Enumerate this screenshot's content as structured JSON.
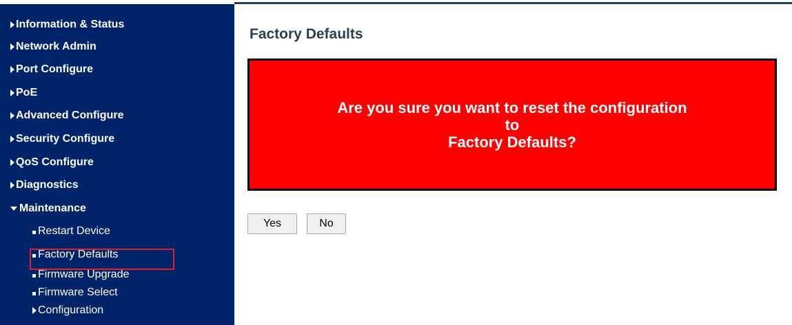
{
  "sidebar": {
    "items": [
      {
        "label": "Information & Status"
      },
      {
        "label": "Network Admin"
      },
      {
        "label": "Port Configure"
      },
      {
        "label": "PoE"
      },
      {
        "label": "Advanced Configure"
      },
      {
        "label": "Security Configure"
      },
      {
        "label": "QoS Configure"
      },
      {
        "label": "Diagnostics"
      },
      {
        "label": "Maintenance"
      }
    ],
    "maintenance_subitems": [
      {
        "label": "Restart Device"
      },
      {
        "label": "Factory Defaults",
        "selected": true
      },
      {
        "label": "Firmware Upgrade"
      },
      {
        "label": "Firmware Select"
      },
      {
        "label": "Configuration"
      }
    ]
  },
  "main": {
    "title": "Factory Defaults",
    "warning": {
      "line1": "Are you sure you want to reset the configuration",
      "line2": "to",
      "line3": "Factory Defaults?"
    },
    "buttons": {
      "yes_label": "Yes",
      "no_label": "No"
    }
  },
  "colors": {
    "sidebar_bg": "#002469",
    "warning_bg": "#ff0000",
    "highlight": "#e0212b"
  }
}
